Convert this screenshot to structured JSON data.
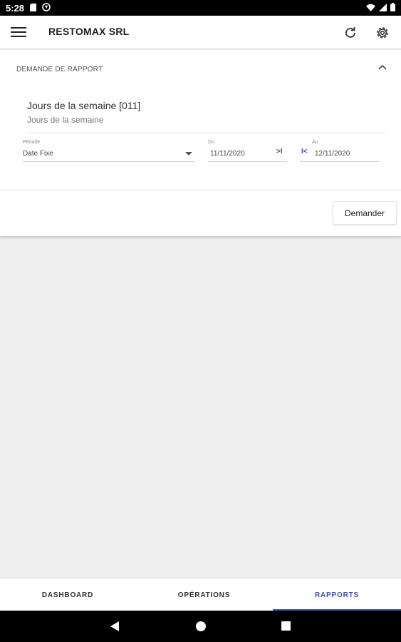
{
  "status_bar": {
    "time": "5:28"
  },
  "app_bar": {
    "title": "RESTOMAX SRL"
  },
  "card": {
    "header": "DEMANDE DE RAPPORT",
    "report_title": "Jours de la semaine [011]",
    "report_subtitle": "Jours de la semaine",
    "periode": {
      "label": "Période",
      "value": "Date Fixe"
    },
    "date_from": {
      "label": "Du",
      "value": "11/11/2020"
    },
    "date_to": {
      "label": "Au",
      "value": "12/11/2020"
    },
    "skip_end_glyph": ">I",
    "skip_start_glyph": "I<",
    "submit_label": "Demander"
  },
  "bottom_nav": {
    "tabs": [
      {
        "label": "DASHBOARD",
        "active": false
      },
      {
        "label": "OPÉRATIONS",
        "active": false
      },
      {
        "label": "RAPPORTS",
        "active": true
      }
    ]
  },
  "colors": {
    "accent": "#3f51b5",
    "background": "#eeeeee"
  }
}
